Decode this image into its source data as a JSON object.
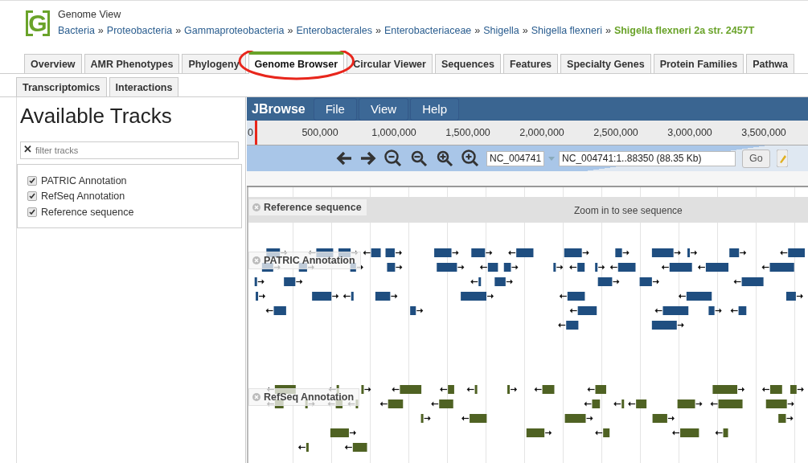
{
  "header": {
    "logo_letter": "G",
    "title": "Genome View",
    "separator": "»",
    "breadcrumbs": [
      {
        "label": "Bacteria",
        "current": false
      },
      {
        "label": "Proteobacteria",
        "current": false
      },
      {
        "label": "Gammaproteobacteria",
        "current": false
      },
      {
        "label": "Enterobacterales",
        "current": false
      },
      {
        "label": "Enterobacteriaceae",
        "current": false
      },
      {
        "label": "Shigella",
        "current": false
      },
      {
        "label": "Shigella flexneri",
        "current": false
      },
      {
        "label": "Shigella flexneri 2a str. 2457T",
        "current": true
      }
    ]
  },
  "tabs": [
    [
      {
        "label": "Overview",
        "selected": false,
        "circled": false
      },
      {
        "label": "AMR Phenotypes",
        "selected": false,
        "circled": false
      },
      {
        "label": "Phylogeny",
        "selected": false,
        "circled": false
      },
      {
        "label": "Genome Browser",
        "selected": true,
        "circled": true
      },
      {
        "label": "Circular Viewer",
        "selected": false,
        "circled": false
      },
      {
        "label": "Sequences",
        "selected": false,
        "circled": false
      },
      {
        "label": "Features",
        "selected": false,
        "circled": false
      },
      {
        "label": "Specialty Genes",
        "selected": false,
        "circled": false
      },
      {
        "label": "Protein Families",
        "selected": false,
        "circled": false
      },
      {
        "label": "Pathwa",
        "selected": false,
        "circled": false
      }
    ],
    [
      {
        "label": "Transcriptomics",
        "selected": false,
        "circled": false
      },
      {
        "label": "Interactions",
        "selected": false,
        "circled": false
      }
    ]
  ],
  "track_selector": {
    "title": "Available Tracks",
    "filter_placeholder": "filter tracks",
    "clear_icon": "✕",
    "tracks": [
      {
        "label": "PATRIC Annotation",
        "checked": true
      },
      {
        "label": "RefSeq Annotation",
        "checked": true
      },
      {
        "label": "Reference sequence",
        "checked": true
      }
    ]
  },
  "jbrowse": {
    "brand": "JBrowse",
    "menus": [
      "File",
      "View",
      "Help"
    ],
    "ruler": [
      "0",
      "500,000",
      "1,000,000",
      "1,500,000",
      "2,000,000",
      "2,500,000",
      "3,000,000",
      "3,500,000"
    ],
    "sequence_select": "NC_004741",
    "location": "NC_004741:1..88350 (88.35 Kb)",
    "go_button": "Go",
    "tracks": [
      {
        "kind": "sequence",
        "label": "Reference sequence",
        "message": "Zoom in to see sequence"
      },
      {
        "kind": "features",
        "label": "PATRIC Annotation",
        "color": "#1f4e80"
      },
      {
        "kind": "features",
        "label": "RefSeq Annotation",
        "color": "#4f6223"
      }
    ]
  }
}
